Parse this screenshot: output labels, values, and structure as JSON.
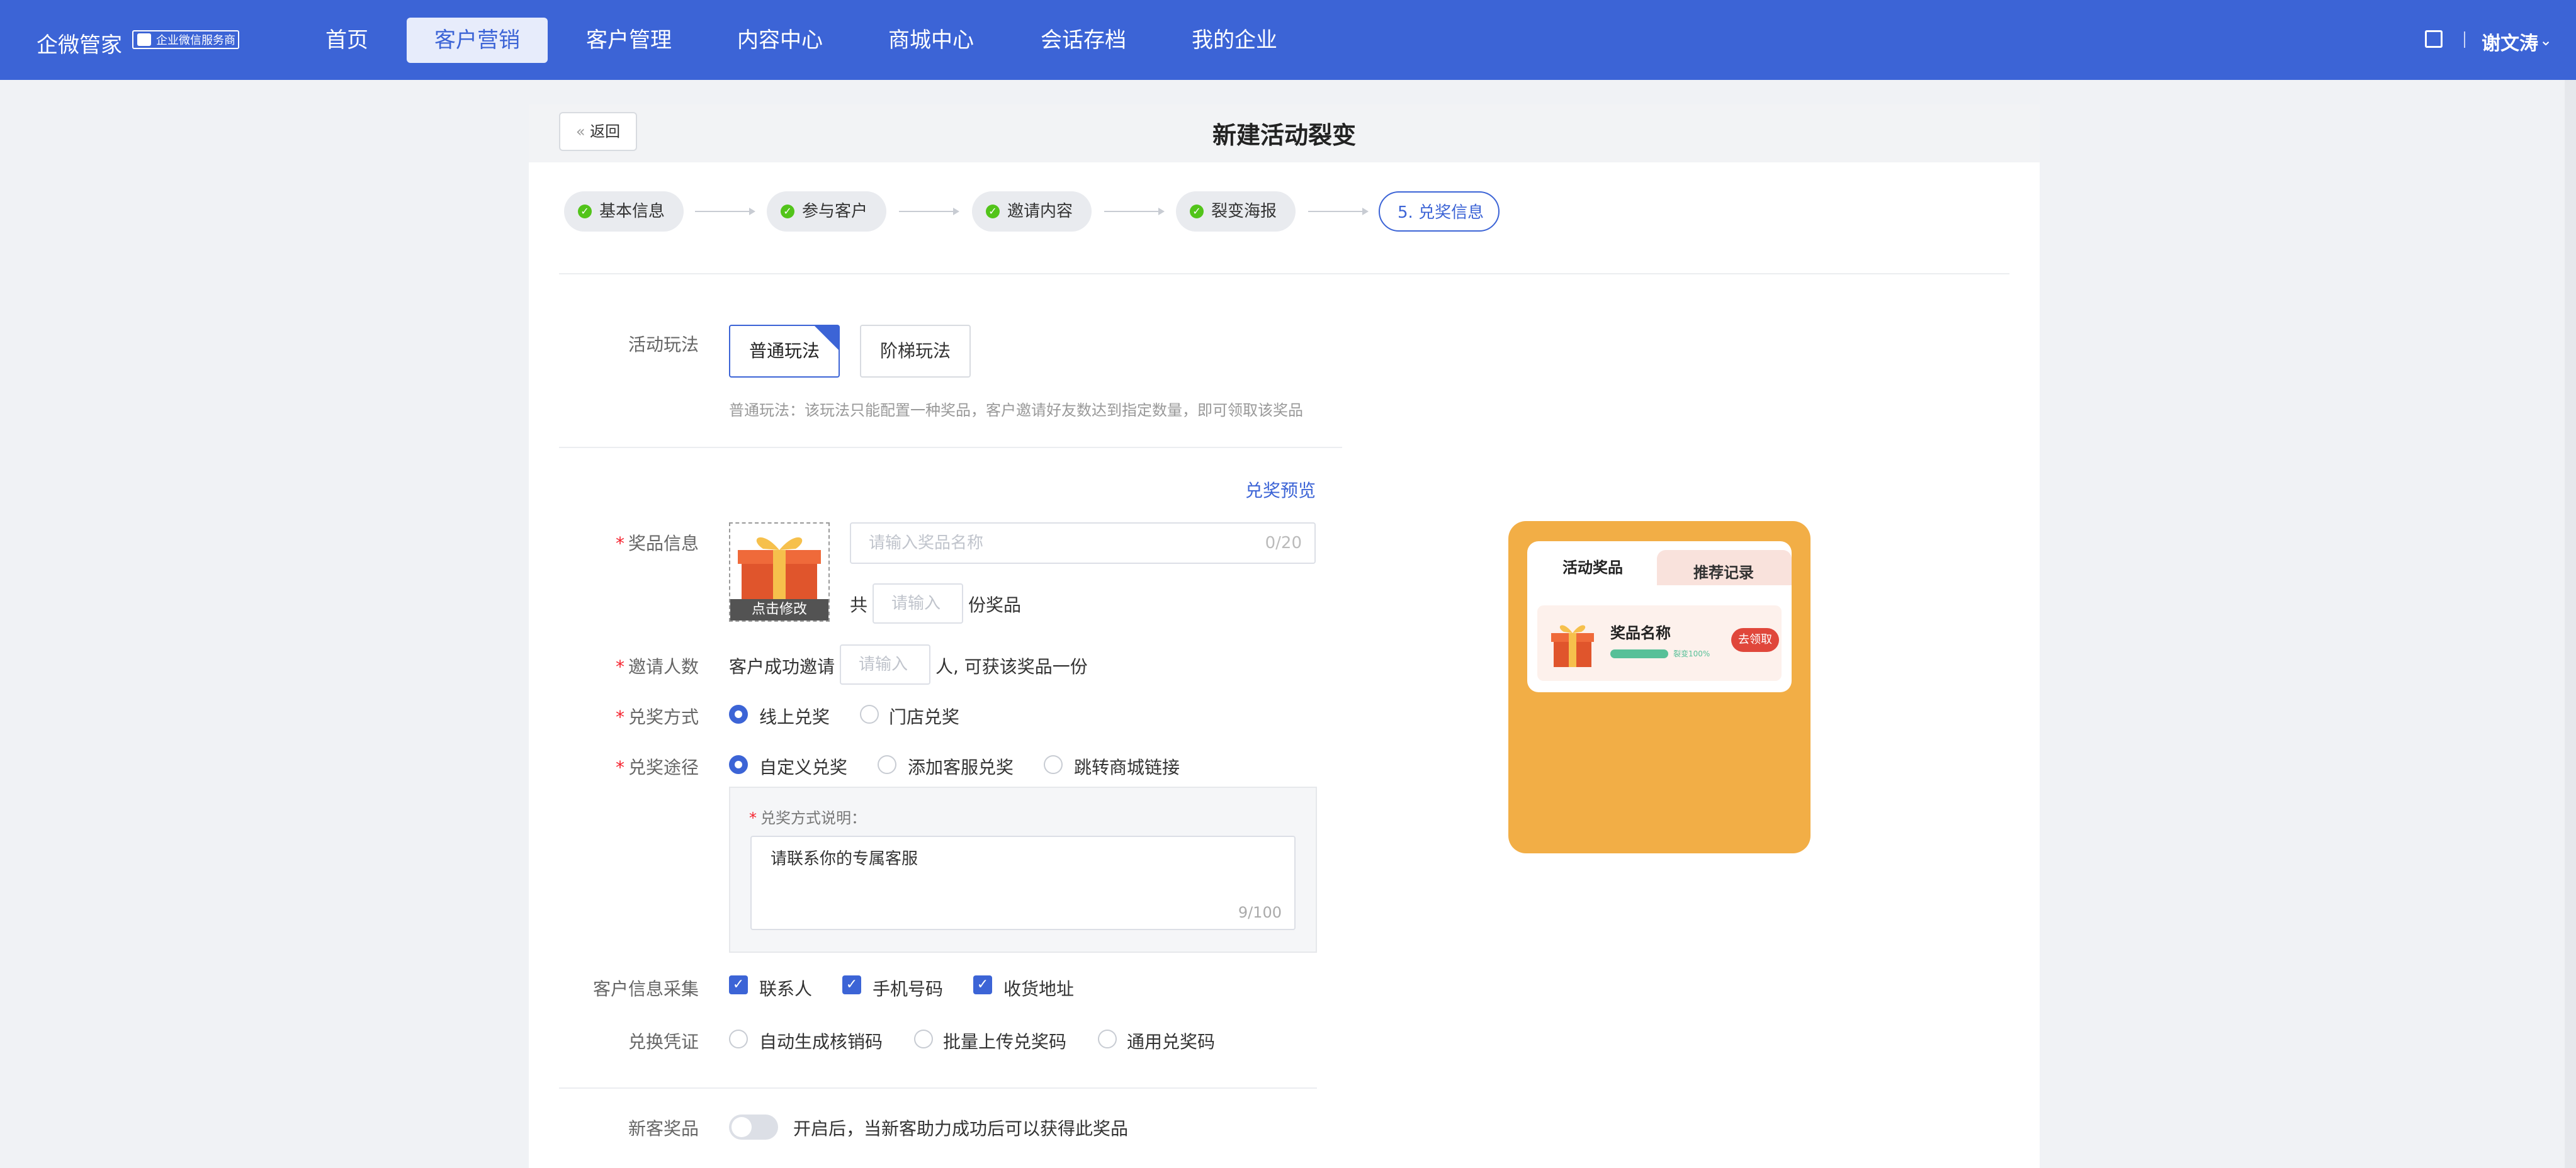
{
  "nav": {
    "brand": "企微管家",
    "badge": "企业微信服务商",
    "items": [
      "首页",
      "客户营销",
      "客户管理",
      "内容中心",
      "商城中心",
      "会话存档",
      "我的企业"
    ],
    "active_index": 1,
    "user": "谢文涛"
  },
  "header": {
    "back": "返回",
    "title": "新建活动裂变"
  },
  "steps": [
    {
      "label": "基本信息",
      "done": true
    },
    {
      "label": "参与客户",
      "done": true
    },
    {
      "label": "邀请内容",
      "done": true
    },
    {
      "label": "裂变海报",
      "done": true
    },
    {
      "label": "5. 兑奖信息",
      "done": false
    }
  ],
  "form": {
    "mode": {
      "label": "活动玩法",
      "options": [
        "普通玩法",
        "阶梯玩法"
      ],
      "selected": "普通玩法",
      "hint": "普通玩法：该玩法只能配置一种奖品，客户邀请好友数达到指定数量，即可领取该奖品"
    },
    "preview_link": "兑奖预览",
    "prize": {
      "label": "奖品信息",
      "image_caption": "点击修改",
      "name_placeholder": "请输入奖品名称",
      "name_count": "0/20",
      "qty_prefix": "共",
      "qty_placeholder": "请输入",
      "qty_suffix": "份奖品"
    },
    "invite": {
      "label": "邀请人数",
      "prefix": "客户成功邀请",
      "placeholder": "请输入",
      "suffix": "人, 可获该奖品一份"
    },
    "redeem_method": {
      "label": "兑奖方式",
      "options": [
        "线上兑奖",
        "门店兑奖"
      ],
      "selected": "线上兑奖"
    },
    "redeem_path": {
      "label": "兑奖途径",
      "options": [
        "自定义兑奖",
        "添加客服兑奖",
        "跳转商城链接"
      ],
      "selected": "自定义兑奖",
      "desc_label": "兑奖方式说明：",
      "desc_value": "请联系你的专属客服",
      "desc_count": "9/100"
    },
    "collect": {
      "label": "客户信息采集",
      "options": [
        "联系人",
        "手机号码",
        "收货地址"
      ],
      "checked": [
        true,
        true,
        true
      ]
    },
    "voucher": {
      "label": "兑换凭证",
      "options": [
        "自动生成核销码",
        "批量上传兑奖码",
        "通用兑奖码"
      ]
    },
    "newcomer": {
      "label": "新客奖品",
      "enabled": false,
      "hint": "开启后，当新客助力成功后可以获得此奖品"
    }
  },
  "preview": {
    "tab_active": "活动奖品",
    "tab_other": "推荐记录",
    "item_name": "奖品名称",
    "progress_text": "裂变100%",
    "progress": 1.0,
    "button": "去领取"
  },
  "colors": {
    "primary": "#3c64d6",
    "success": "#52c41a",
    "preview_bg": "#f2ae46",
    "danger": "#e0473b"
  }
}
